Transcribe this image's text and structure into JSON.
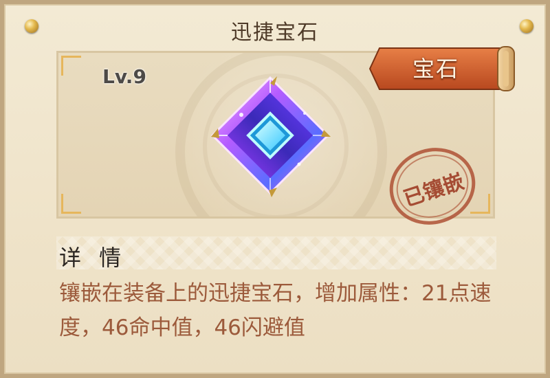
{
  "title": "迅捷宝石",
  "item": {
    "level": "Lv.9",
    "category": "宝石",
    "status_stamp": "已镶嵌",
    "icon": "gem-icon"
  },
  "details": {
    "heading": "详 情",
    "description": "镶嵌在装备上的迅捷宝石，增加属性：21点速度，46命中值，46闪避值"
  },
  "colors": {
    "description_text": "#9c5a3b",
    "ribbon": "#c2562a",
    "stamp": "#ac4c30",
    "gem_primary": "#7a5cff",
    "gem_center": "#6ff2ff"
  }
}
